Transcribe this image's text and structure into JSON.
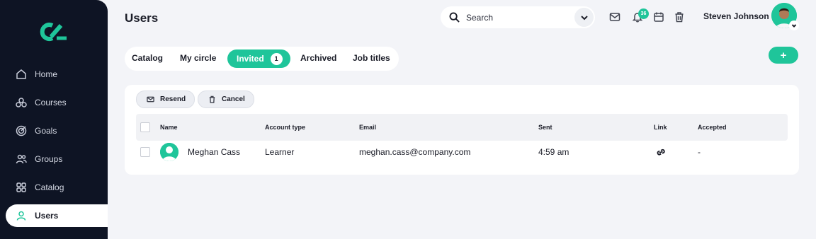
{
  "app": {
    "page_title": "Users",
    "accent": "#1fc59a",
    "sidebar_bg": "#0e1424"
  },
  "sidebar": {
    "items": [
      {
        "label": "Home",
        "icon": "home-icon"
      },
      {
        "label": "Courses",
        "icon": "courses-icon"
      },
      {
        "label": "Goals",
        "icon": "goals-icon"
      },
      {
        "label": "Groups",
        "icon": "groups-icon"
      },
      {
        "label": "Catalog",
        "icon": "catalog-icon"
      },
      {
        "label": "Users",
        "icon": "user-icon",
        "active": true
      }
    ]
  },
  "header": {
    "search_placeholder": "Search",
    "notification_count": "36",
    "user_name": "Steven Johnson",
    "icons": [
      "mail-icon",
      "bell-icon",
      "calendar-icon",
      "trash-icon"
    ]
  },
  "tabs": [
    {
      "label": "Catalog"
    },
    {
      "label": "My circle"
    },
    {
      "label": "Invited",
      "count": "1",
      "active": true
    },
    {
      "label": "Archived"
    },
    {
      "label": "Job titles"
    }
  ],
  "actions": {
    "add_label": "+",
    "resend_label": "Resend",
    "cancel_label": "Cancel"
  },
  "table": {
    "columns": [
      "Name",
      "Account type",
      "Email",
      "Sent",
      "Link",
      "Accepted"
    ],
    "rows": [
      {
        "name": "Meghan Cass",
        "account_type": "Learner",
        "email": "meghan.cass@company.com",
        "sent": "4:59 am",
        "link": "link-icon",
        "accepted": "-"
      }
    ]
  }
}
